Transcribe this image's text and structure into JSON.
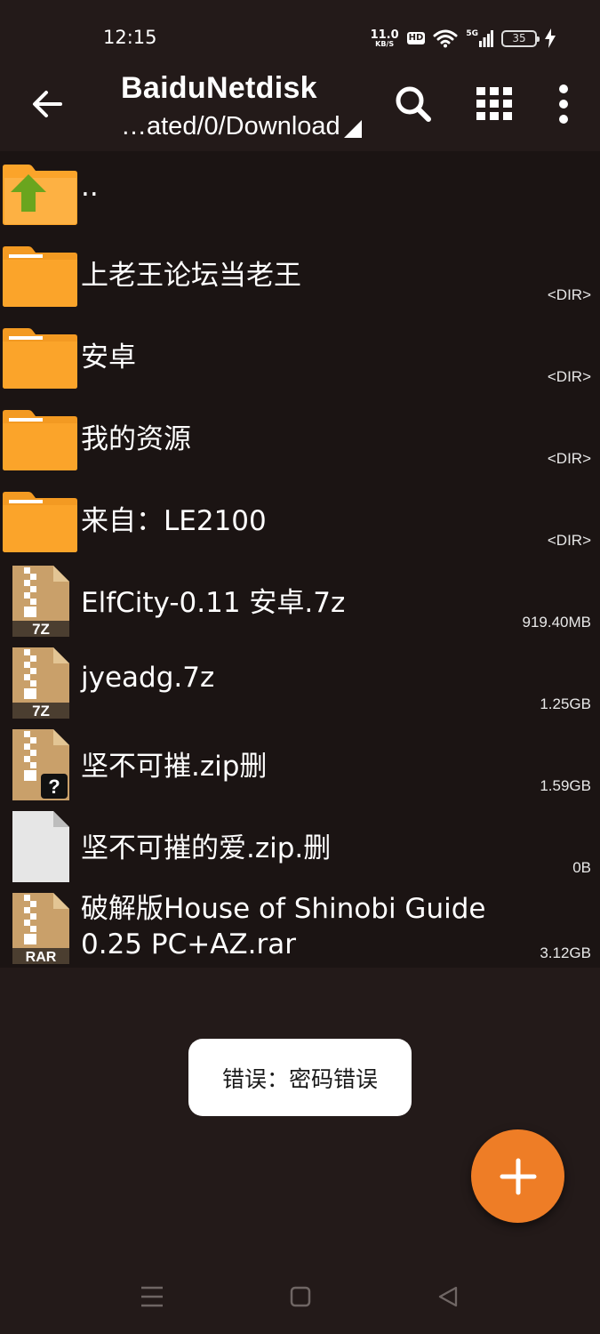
{
  "status_bar": {
    "time": "12:15",
    "net_speed": "11.0",
    "net_speed_unit": "KB/S",
    "hd": "HD",
    "network": "5G",
    "battery": "35"
  },
  "header": {
    "title": "BaiduNetdisk",
    "path": "…ated/0/Download"
  },
  "files": [
    {
      "name": "..",
      "meta": "",
      "icon": "parent-folder-icon"
    },
    {
      "name": "上老王论坛当老王",
      "meta": "<DIR>",
      "icon": "folder-icon"
    },
    {
      "name": "安卓",
      "meta": "<DIR>",
      "icon": "folder-icon"
    },
    {
      "name": "我的资源",
      "meta": "<DIR>",
      "icon": "folder-icon"
    },
    {
      "name": "来自：LE2100",
      "meta": "<DIR>",
      "icon": "folder-icon"
    },
    {
      "name": "ElfCity-0.11 安卓.7z",
      "meta": "919.40MB",
      "icon": "archive-7z-icon",
      "badge": "7Z"
    },
    {
      "name": "jyeadg.7z",
      "meta": "1.25GB",
      "icon": "archive-7z-icon",
      "badge": "7Z"
    },
    {
      "name": "坚不可摧.zip删",
      "meta": "1.59GB",
      "icon": "archive-unknown-icon",
      "badge": "?"
    },
    {
      "name": "坚不可摧的爱.zip.删",
      "meta": "0B",
      "icon": "blank-file-icon"
    },
    {
      "name_line1": "破解版House of Shinobi Guide",
      "name_line2": "0.25 PC+AZ.rar",
      "meta": "3.12GB",
      "icon": "archive-rar-icon",
      "badge": "RAR"
    }
  ],
  "toast": {
    "message": "错误：密码错误"
  },
  "colors": {
    "background": "#231a19",
    "list_background": "#1b1413",
    "folder": "#fba42a",
    "archive": "#c9a06a",
    "fab": "#ee7d26",
    "up_arrow": "#6aa51e"
  }
}
